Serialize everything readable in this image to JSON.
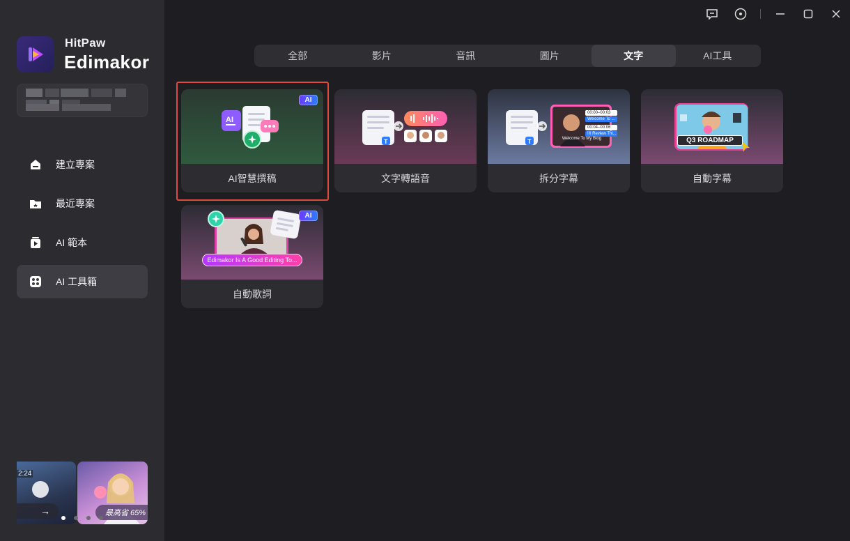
{
  "brand": {
    "top": "HitPaw",
    "main": "Edimakor"
  },
  "sidebar": {
    "items": [
      {
        "label": "建立專案",
        "icon": "home-icon"
      },
      {
        "label": "最近專案",
        "icon": "folder-icon"
      },
      {
        "label": "AI 範本",
        "icon": "template-icon"
      },
      {
        "label": "AI 工具箱",
        "icon": "toolbox-icon"
      }
    ],
    "active_index": 3
  },
  "promo": {
    "time": "2:24",
    "save_text": "最高省 65%"
  },
  "window": {
    "controls": [
      "feedback-icon",
      "settings-icon",
      "minimize-icon",
      "maximize-icon",
      "close-icon"
    ]
  },
  "tabs": [
    {
      "label": "全部"
    },
    {
      "label": "影片"
    },
    {
      "label": "音訊"
    },
    {
      "label": "圖片"
    },
    {
      "label": "文字"
    },
    {
      "label": "AI工具"
    }
  ],
  "active_tab": "文字",
  "cards": [
    {
      "title": "AI智慧撰稿",
      "badge": "AI"
    },
    {
      "title": "文字轉語音"
    },
    {
      "title": "拆分字幕",
      "subs": [
        "00:00–00:03",
        "Welcome To ...",
        "00:04–00:06",
        "I'll Review Thi..."
      ],
      "caption": "Welcome To My Blog"
    },
    {
      "title": "自動字幕",
      "caption": "Q3 ROADMAP"
    },
    {
      "title": "自動歌詞",
      "badge": "AI",
      "caption": "Edimakor Is A Good Editing To..."
    }
  ],
  "colors": {
    "accent": "#6a3cff",
    "highlight_border": "#e04a3c",
    "panel": "#2b2b30",
    "background": "#1e1e22"
  }
}
